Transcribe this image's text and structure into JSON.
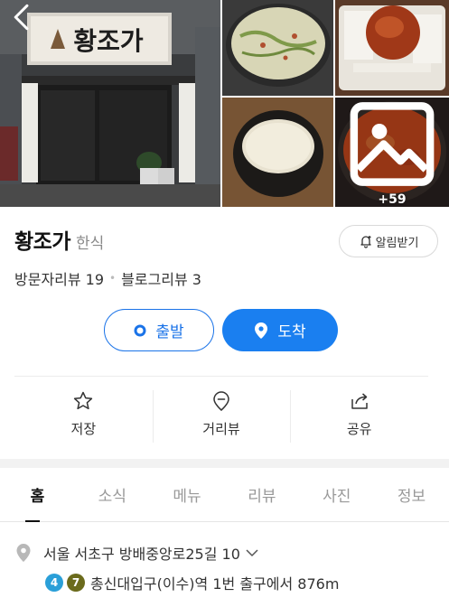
{
  "gallery": {
    "more_count": "+59"
  },
  "place": {
    "name": "황조가",
    "category": "한식",
    "sign_text": "황조가"
  },
  "notify": {
    "label": "알림받기"
  },
  "reviews": {
    "visitor": "방문자리뷰 19",
    "blog": "블로그리뷰 3"
  },
  "route": {
    "start_label": "출발",
    "end_label": "도착"
  },
  "actions": [
    {
      "label": "저장",
      "icon": "star-icon"
    },
    {
      "label": "거리뷰",
      "icon": "streetview-icon"
    },
    {
      "label": "공유",
      "icon": "share-icon"
    }
  ],
  "tabs": [
    {
      "label": "홈",
      "active": true
    },
    {
      "label": "소식",
      "active": false
    },
    {
      "label": "메뉴",
      "active": false
    },
    {
      "label": "리뷰",
      "active": false
    },
    {
      "label": "사진",
      "active": false
    },
    {
      "label": "정보",
      "active": false
    }
  ],
  "address": {
    "text": "서울 서초구 방배중앙로25길 10",
    "subway_lines": [
      {
        "number": "4",
        "color": "#2a9fd8"
      },
      {
        "number": "7",
        "color": "#6b6b1c"
      }
    ],
    "subway_text": "총신대입구(이수)역 1번 출구에서 876m"
  },
  "colors": {
    "accent": "#1a7ff0",
    "accent_border": "#1a73e8"
  }
}
